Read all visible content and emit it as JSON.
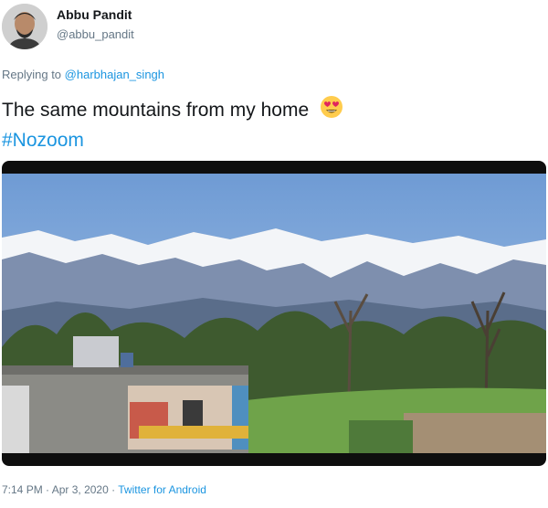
{
  "tweet": {
    "author_name": "Abbu Pandit",
    "author_handle": "@abbu_pandit",
    "replying_prefix": "Replying to",
    "replying_to": "@harbhajan_singh",
    "text": "The same mountains from my home",
    "emoji": "heart-eyes-emoji",
    "hashtag": "#Nozoom",
    "time": "7:14 PM",
    "date": "Apr 3, 2020",
    "source": "Twitter for Android",
    "separator": "·"
  },
  "colors": {
    "link": "#1b95e0",
    "secondary_text": "#657786",
    "primary_text": "#14171a"
  }
}
